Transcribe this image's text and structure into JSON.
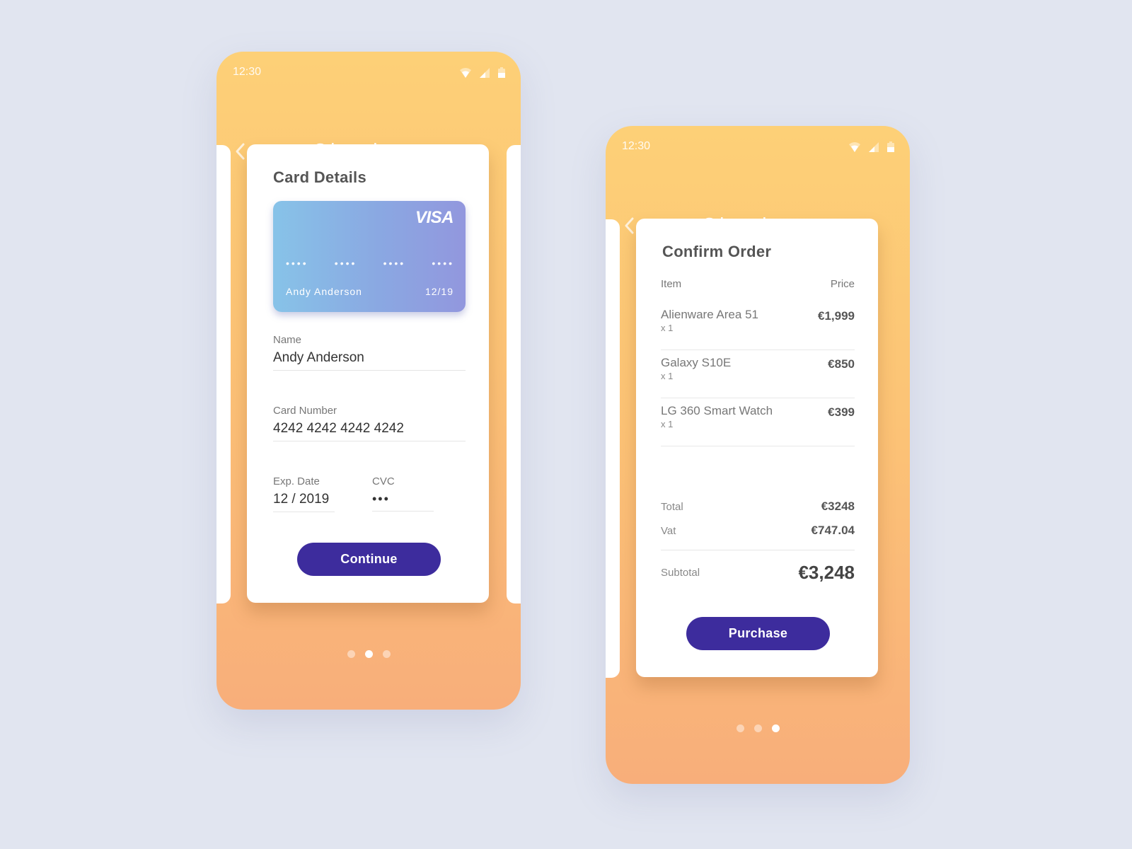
{
  "screens": [
    {
      "status_bar": {
        "time": "12:30",
        "icons": [
          "wifi-icon",
          "signal-icon",
          "battery-icon"
        ]
      },
      "app_bar": {
        "title": "Checkout",
        "back_icon": "chevron-left-icon"
      },
      "card": {
        "heading": "Card Details",
        "credit_card": {
          "brand": "VISA",
          "masked_groups": [
            "••••",
            "••••",
            "••••",
            "••••"
          ],
          "holder": "Andy Anderson",
          "expiry": "12/19",
          "gradient_colors": [
            "#87c3e8",
            "#9297de"
          ]
        },
        "fields": {
          "name": {
            "label": "Name",
            "value": "Andy Anderson"
          },
          "card_number": {
            "label": "Card Number",
            "value": "4242 4242 4242 4242"
          },
          "exp_date": {
            "label": "Exp. Date",
            "value": "12 / 2019"
          },
          "cvc": {
            "label": "CVC",
            "value": "•••"
          }
        },
        "button_label": "Continue"
      },
      "pager": {
        "count": 3,
        "active_index": 1
      }
    },
    {
      "status_bar": {
        "time": "12:30",
        "icons": [
          "wifi-icon",
          "signal-icon",
          "battery-icon"
        ]
      },
      "app_bar": {
        "title": "Checkout",
        "back_icon": "chevron-left-icon"
      },
      "card": {
        "heading": "Confirm Order",
        "columns": {
          "item": "Item",
          "price": "Price"
        },
        "items": [
          {
            "name": "Alienware Area 51",
            "qty": "x 1",
            "price": "€1,999"
          },
          {
            "name": "Galaxy S10E",
            "qty": "x 1",
            "price": "€850"
          },
          {
            "name": "LG 360 Smart Watch",
            "qty": "x 1",
            "price": "€399"
          }
        ],
        "totals": {
          "total_label": "Total",
          "total_value": "€3248",
          "vat_label": "Vat",
          "vat_value": "€747.04",
          "subtotal_label": "Subtotal",
          "subtotal_value": "€3,248"
        },
        "button_label": "Purchase"
      },
      "pager": {
        "count": 3,
        "active_index": 2
      }
    }
  ],
  "colors": {
    "background": "#e1e5f0",
    "header_gradient_top": "#fdd077",
    "header_gradient_bottom": "#f8ae7a",
    "primary_button": "#3d2c9d"
  }
}
